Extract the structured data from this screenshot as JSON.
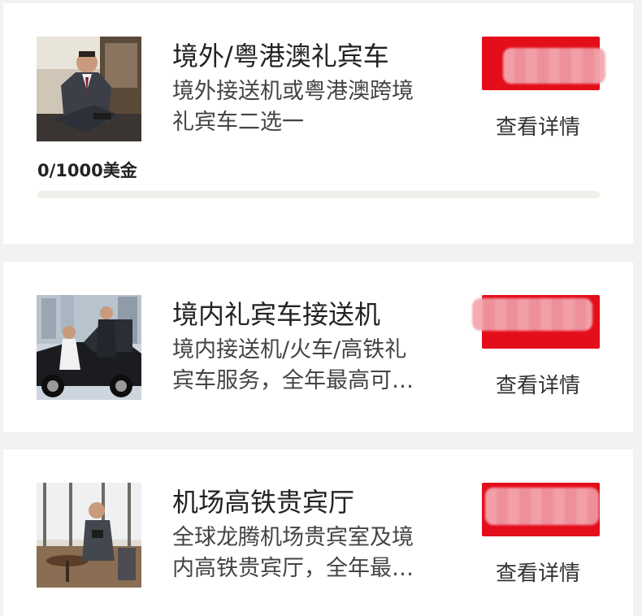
{
  "benefits": [
    {
      "title": "境外/粤港澳礼宾车",
      "desc_lines": [
        "境外接送机或粤港澳跨境",
        "礼宾车二选一"
      ],
      "action": "查看详情"
    },
    {
      "title": "境内礼宾车接送机",
      "desc_lines": [
        "境内接送机/火车/高铁礼",
        "宾车服务，全年最高可…"
      ],
      "action": "查看详情"
    },
    {
      "title": "机场高铁贵宾厅",
      "desc_lines": [
        "全球龙腾机场贵宾室及境",
        "内高铁贵宾厅，全年最…"
      ],
      "action": "查看详情"
    }
  ],
  "progress": {
    "text": "0/1000美金",
    "current": 0,
    "total": 1000,
    "fraction": 0
  },
  "colors": {
    "accent": "#e30e1a",
    "track": "#f1efe9",
    "page_bg": "#f2f2f2"
  }
}
